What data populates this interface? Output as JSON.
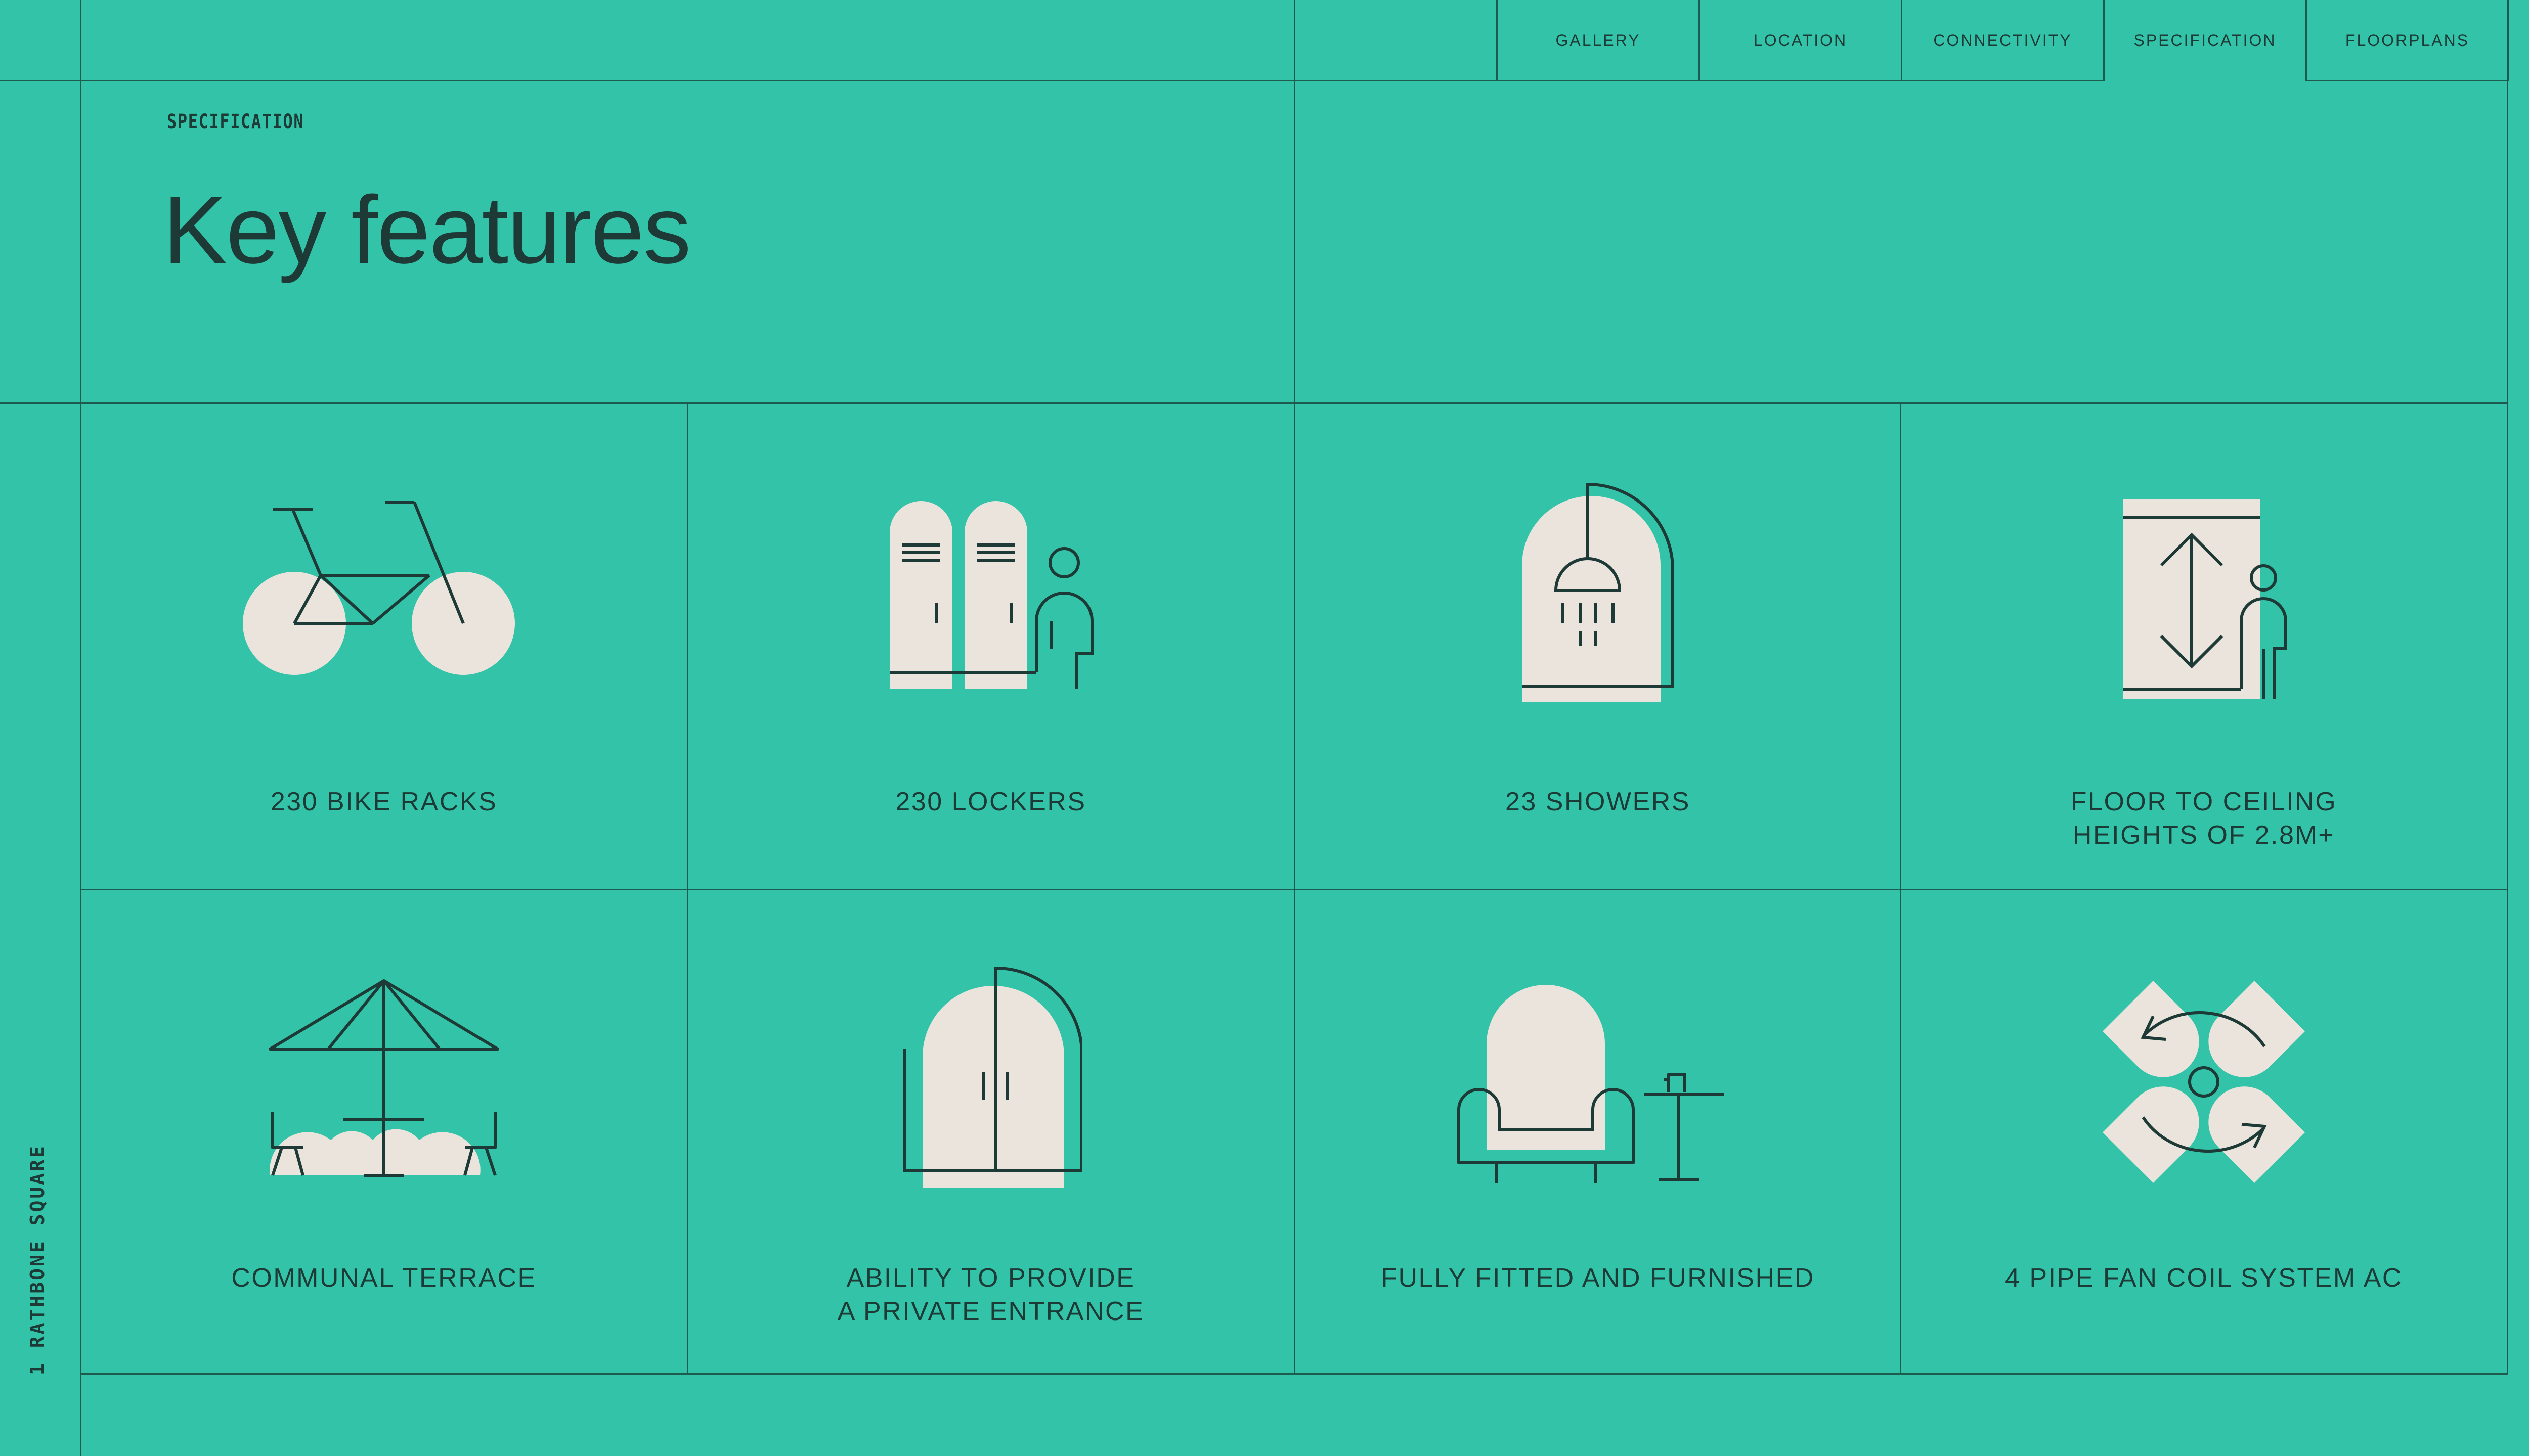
{
  "nav": {
    "items": [
      {
        "label": "GALLERY"
      },
      {
        "label": "LOCATION"
      },
      {
        "label": "CONNECTIVITY"
      },
      {
        "label": "SPECIFICATION",
        "active": true
      },
      {
        "label": "FLOORPLANS"
      }
    ],
    "menu_icon": "dome-menu-icon"
  },
  "section": {
    "eyebrow": "SPECIFICATION",
    "title": "Key features"
  },
  "brand": "1 RATHBONE SQUARE",
  "features": [
    {
      "icon": "bicycle-icon",
      "line1": "230 BIKE RACKS",
      "line2": ""
    },
    {
      "icon": "lockers-icon",
      "line1": "230 LOCKERS",
      "line2": ""
    },
    {
      "icon": "shower-icon",
      "line1": "23 SHOWERS",
      "line2": ""
    },
    {
      "icon": "ceiling-height-icon",
      "line1": "FLOOR TO CEILING",
      "line2": "HEIGHTS OF 2.8M+"
    },
    {
      "icon": "terrace-umbrella-icon",
      "line1": "COMMUNAL TERRACE",
      "line2": ""
    },
    {
      "icon": "private-entrance-door-icon",
      "line1": "ABILITY TO PROVIDE",
      "line2": "A PRIVATE ENTRANCE"
    },
    {
      "icon": "armchair-icon",
      "line1": "FULLY FITTED AND FURNISHED",
      "line2": ""
    },
    {
      "icon": "fan-coil-icon",
      "line1": "4 PIPE FAN COIL SYSTEM AC",
      "line2": ""
    }
  ],
  "colors": {
    "background": "#33c3a8",
    "ink": "#1d3a36",
    "icon_fill": "#ebe4dd",
    "rule": "#1f5a4f"
  }
}
